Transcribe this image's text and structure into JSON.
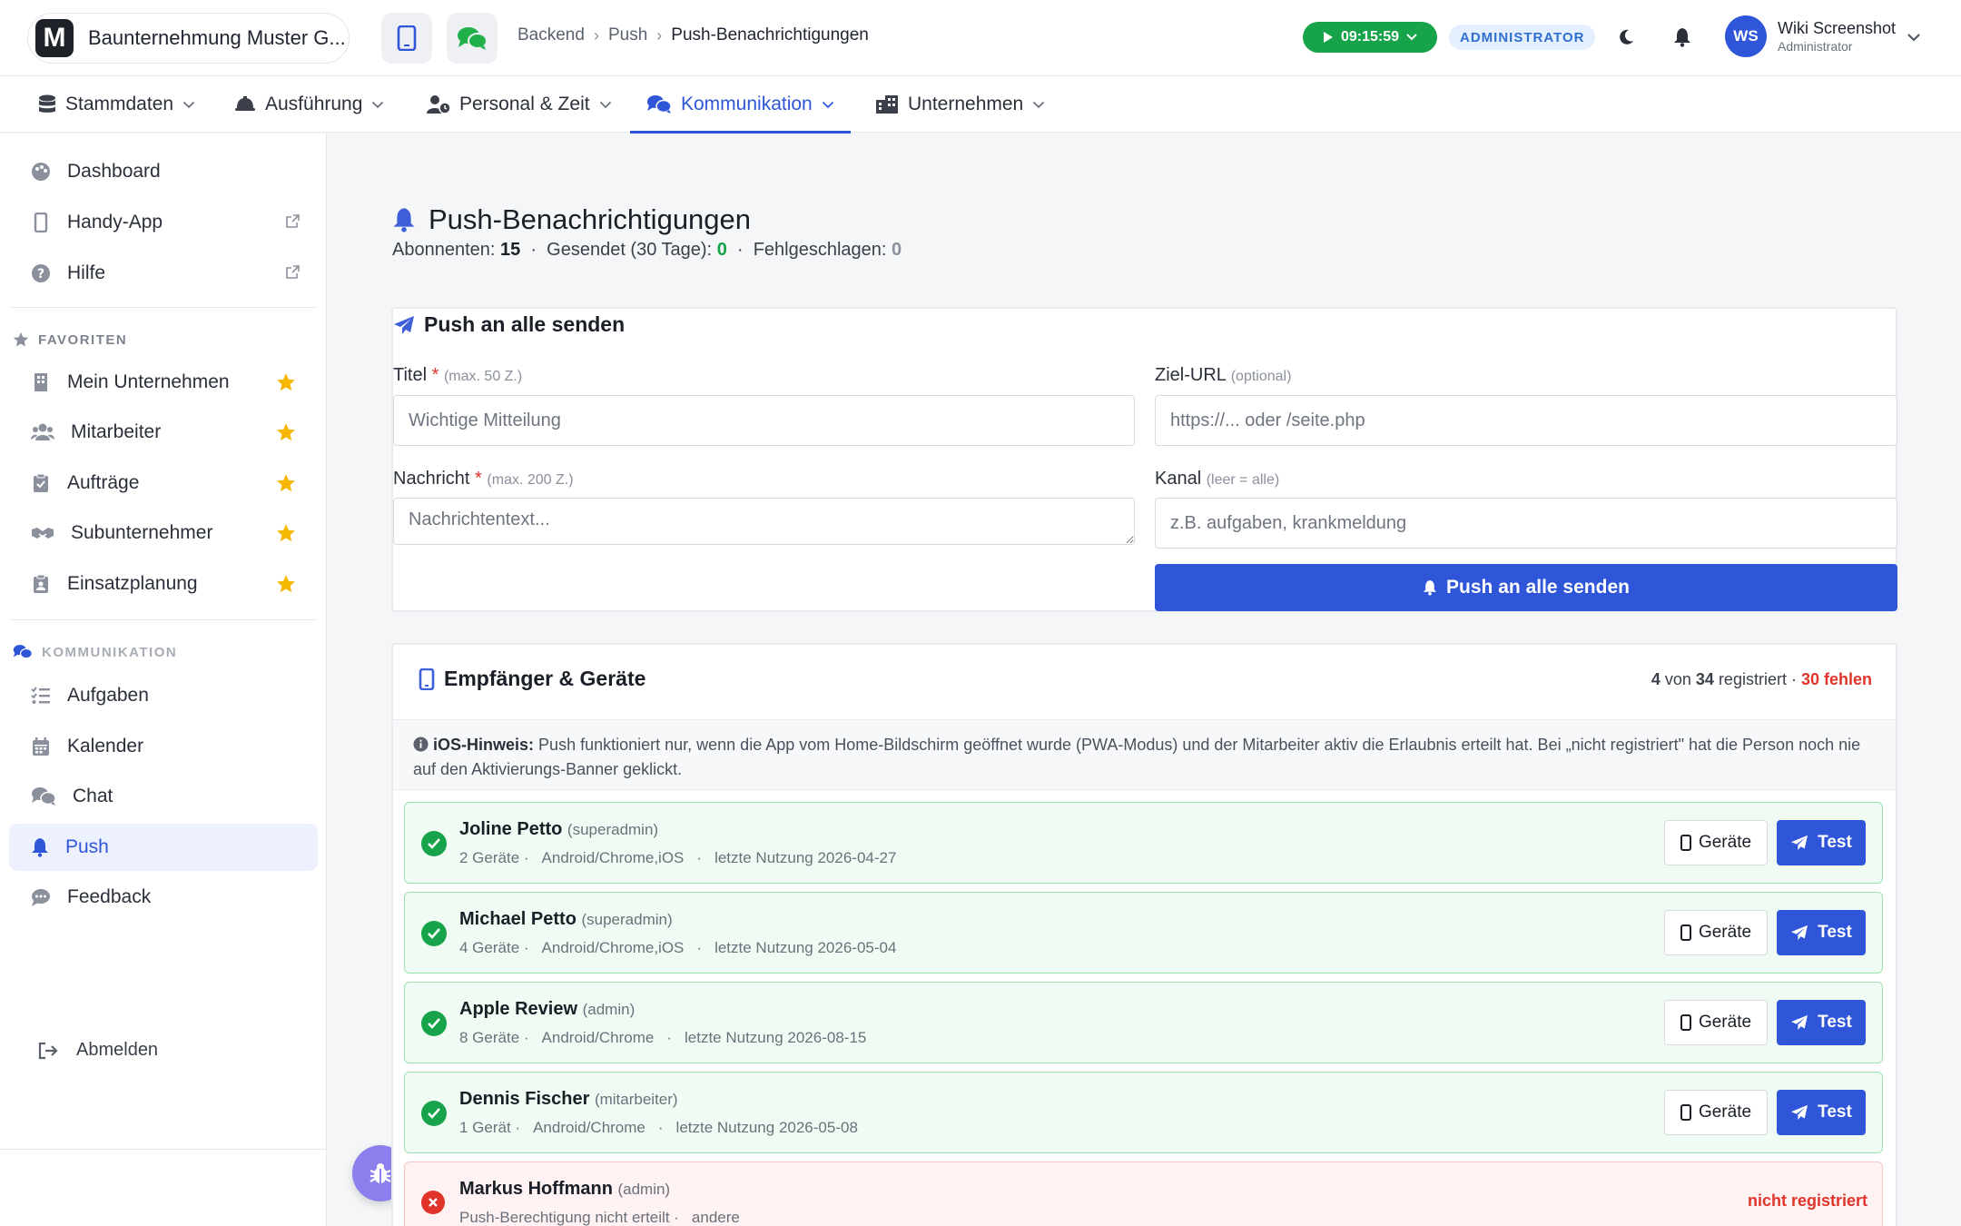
{
  "header": {
    "company_logo_letter": "M",
    "company_name": "Baunternehmung Muster G...",
    "breadcrumb": [
      "Backend",
      "Push",
      "Push-Benachrichtigungen"
    ],
    "timer": "09:15:59",
    "role_badge": "ADMINISTRATOR",
    "user_initials": "WS",
    "user_name": "Wiki Screenshot",
    "user_role": "Administrator"
  },
  "mainnav": [
    {
      "label": "Stammdaten",
      "icon": "database-icon"
    },
    {
      "label": "Ausführung",
      "icon": "helmet-icon"
    },
    {
      "label": "Personal & Zeit",
      "icon": "user-clock-icon"
    },
    {
      "label": "Kommunikation",
      "icon": "comments-icon",
      "active": true
    },
    {
      "label": "Unternehmen",
      "icon": "building-icon"
    }
  ],
  "sidebar": {
    "top": [
      {
        "label": "Dashboard",
        "icon": "palette-icon"
      },
      {
        "label": "Handy-App",
        "icon": "phone-icon",
        "external": true
      },
      {
        "label": "Hilfe",
        "icon": "help-icon",
        "external": true
      }
    ],
    "favorites_heading": "FAVORITEN",
    "favorites": [
      {
        "label": "Mein Unternehmen",
        "icon": "building-icon"
      },
      {
        "label": "Mitarbeiter",
        "icon": "users-icon"
      },
      {
        "label": "Aufträge",
        "icon": "clipboard-check-icon"
      },
      {
        "label": "Subunternehmer",
        "icon": "handshake-icon"
      },
      {
        "label": "Einsatzplanung",
        "icon": "clipboard-user-icon"
      }
    ],
    "comm_heading": "KOMMUNIKATION",
    "comm": [
      {
        "label": "Aufgaben",
        "icon": "list-check-icon"
      },
      {
        "label": "Kalender",
        "icon": "calendar-icon"
      },
      {
        "label": "Chat",
        "icon": "chat-icon"
      },
      {
        "label": "Push",
        "icon": "bell-icon",
        "active": true
      },
      {
        "label": "Feedback",
        "icon": "comment-dots-icon"
      }
    ],
    "logout": "Abmelden"
  },
  "page": {
    "title": "Push-Benachrichtigungen",
    "stats": {
      "subscribers_label": "Abonnenten:",
      "subscribers": "15",
      "sent_label": "Gesendet (30 Tage):",
      "sent": "0",
      "failed_label": "Fehlgeschlagen:",
      "failed": "0"
    }
  },
  "send_form": {
    "title": "Push an alle senden",
    "title_label": "Titel",
    "title_hint": "(max. 50 Z.)",
    "title_placeholder": "Wichtige Mitteilung",
    "url_label": "Ziel-URL",
    "url_hint": "(optional)",
    "url_placeholder": "https://... oder /seite.php",
    "message_label": "Nachricht",
    "message_hint": "(max. 200 Z.)",
    "message_placeholder": "Nachrichtentext...",
    "channel_label": "Kanal",
    "channel_hint": "(leer = alle)",
    "channel_placeholder": "z.B. aufgaben, krankmeldung",
    "send_button": "Push an alle senden"
  },
  "recipients": {
    "title": "Empfänger & Geräte",
    "registered": "4",
    "registered_of": "von",
    "total": "34",
    "registered_label": "registriert ·",
    "missing": "30 fehlen",
    "hint_bold": "iOS-Hinweis:",
    "hint_text": "Push funktioniert nur, wenn die App vom Home-Bildschirm geöffnet wurde (PWA-Modus) und der Mitarbeiter aktiv die Erlaubnis erteilt hat. Bei „nicht registriert\" hat die Person noch nie auf den Aktivierungs-Banner geklickt.",
    "devices_button": "Geräte",
    "test_button": "Test",
    "not_registered": "nicht registriert",
    "list": [
      {
        "name": "Joline Petto",
        "role": "(superadmin)",
        "devices": "2 Geräte ·",
        "platform": "Android/Chrome,iOS",
        "last": "letzte Nutzung 2026-04-27",
        "ok": true
      },
      {
        "name": "Michael Petto",
        "role": "(superadmin)",
        "devices": "4 Geräte ·",
        "platform": "Android/Chrome,iOS",
        "last": "letzte Nutzung 2026-05-04",
        "ok": true
      },
      {
        "name": "Apple Review",
        "role": "(admin)",
        "devices": "8 Geräte ·",
        "platform": "Android/Chrome",
        "last": "letzte Nutzung 2026-08-15",
        "ok": true
      },
      {
        "name": "Dennis Fischer",
        "role": "(mitarbeiter)",
        "devices": "1 Gerät ·",
        "platform": "Android/Chrome",
        "last": "letzte Nutzung 2026-05-08",
        "ok": true
      },
      {
        "name": "Markus Hoffmann",
        "role": "(admin)",
        "devices": "Push-Berechtigung nicht erteilt ·",
        "platform": "andere",
        "last": "",
        "ok": false
      }
    ]
  },
  "colors": {
    "primary": "#2f56d9",
    "success": "#17a34a",
    "danger": "#e0342b",
    "star": "#f5b700"
  }
}
